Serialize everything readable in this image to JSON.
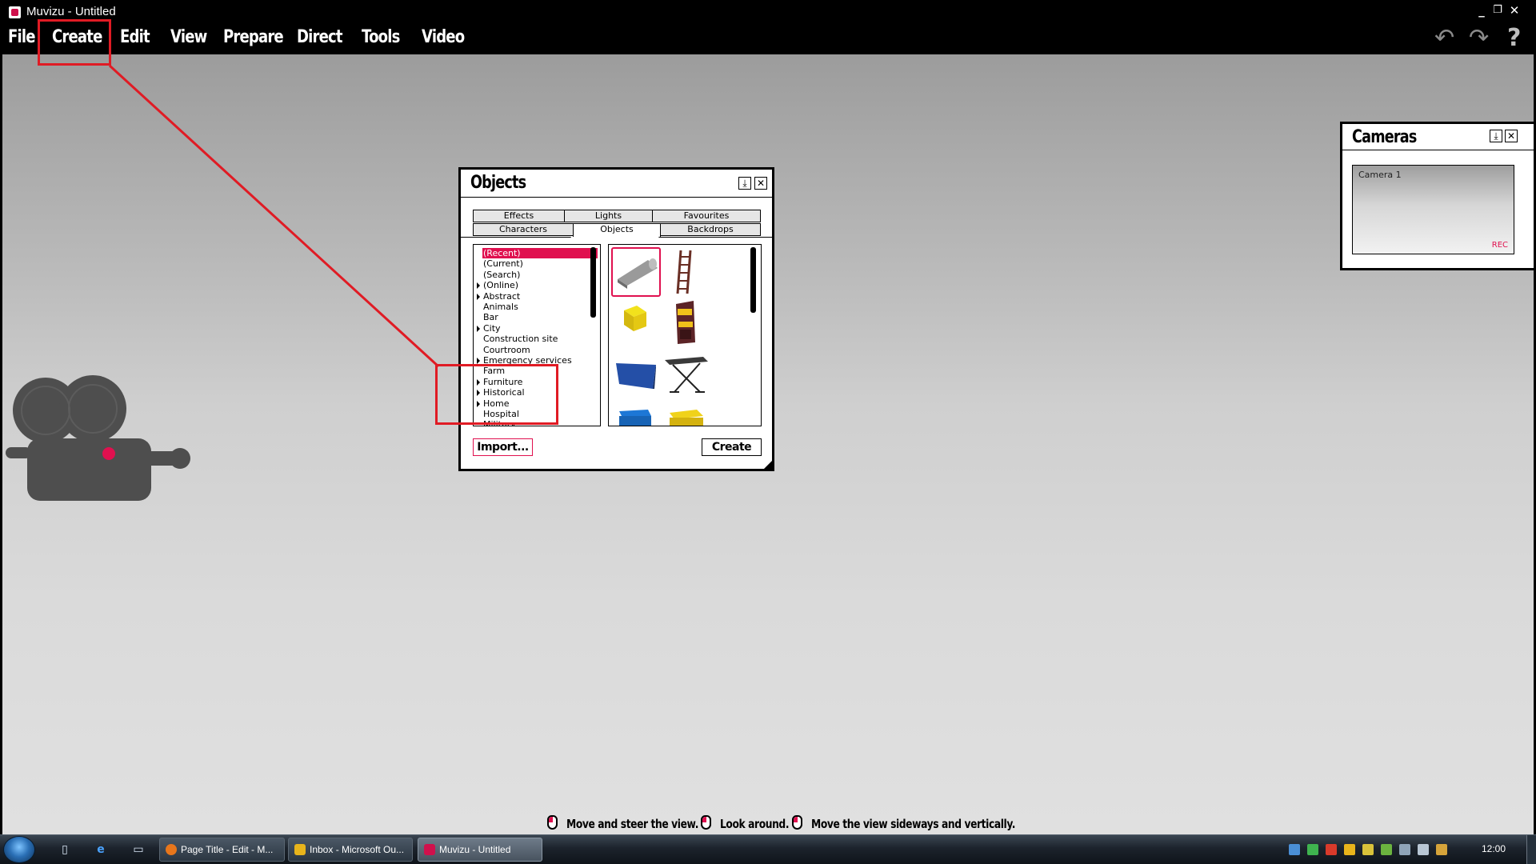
{
  "window": {
    "title": "Muvizu - Untitled",
    "controls": {
      "minimize": "_",
      "restore": "❐",
      "close": "✕"
    }
  },
  "menu": [
    "File",
    "Create",
    "Edit",
    "View",
    "Prepare",
    "Direct",
    "Tools",
    "Video"
  ],
  "toolbar_icons": [
    "undo-icon",
    "redo-icon",
    "help-icon"
  ],
  "objects_panel": {
    "title": "Objects",
    "tabs_row1": [
      "Effects",
      "Lights",
      "Favourites"
    ],
    "tabs_row2": [
      "Characters",
      "Objects",
      "Backdrops"
    ],
    "active_tab": "Objects",
    "categories": [
      {
        "label": "(Recent)",
        "expandable": false,
        "selected": true
      },
      {
        "label": "(Current)",
        "expandable": false
      },
      {
        "label": "(Search)",
        "expandable": false
      },
      {
        "label": "(Online)",
        "expandable": true
      },
      {
        "label": "Abstract",
        "expandable": true
      },
      {
        "label": "Animals",
        "expandable": false
      },
      {
        "label": "Bar",
        "expandable": false
      },
      {
        "label": "City",
        "expandable": true
      },
      {
        "label": "Construction site",
        "expandable": false
      },
      {
        "label": "Courtroom",
        "expandable": false
      },
      {
        "label": "Emergency services",
        "expandable": true
      },
      {
        "label": "Farm",
        "expandable": false
      },
      {
        "label": "Furniture",
        "expandable": true
      },
      {
        "label": "Historical",
        "expandable": true
      },
      {
        "label": "Home",
        "expandable": true
      },
      {
        "label": "Hospital",
        "expandable": false
      },
      {
        "label": "Military",
        "expandable": false
      }
    ],
    "thumbnails": [
      "pipe-object",
      "ladder-object",
      "yellow-cube-object",
      "arcade-machine-object",
      "blue-panel-object",
      "keyboard-stand-object",
      "blue-box-object",
      "yellow-box-object"
    ],
    "import_label": "Import...",
    "create_label": "Create"
  },
  "cameras_panel": {
    "title": "Cameras",
    "camera_name": "Camera 1",
    "rec_label": "REC"
  },
  "hints": [
    "Move and steer the view.",
    "Look around.",
    "Move the view sideways and vertically."
  ],
  "taskbar": {
    "windows": [
      {
        "label": "Page Title - Edit - M...",
        "icon_color": "#e8761b",
        "active": false
      },
      {
        "label": "Inbox - Microsoft Ou...",
        "icon_color": "#e8b41b",
        "active": false
      },
      {
        "label": "Muvizu - Untitled",
        "icon_color": "#d0104c",
        "active": true
      }
    ],
    "clock": "12:00"
  },
  "colors": {
    "accent": "#e0104f",
    "annotation": "#e01b24"
  }
}
